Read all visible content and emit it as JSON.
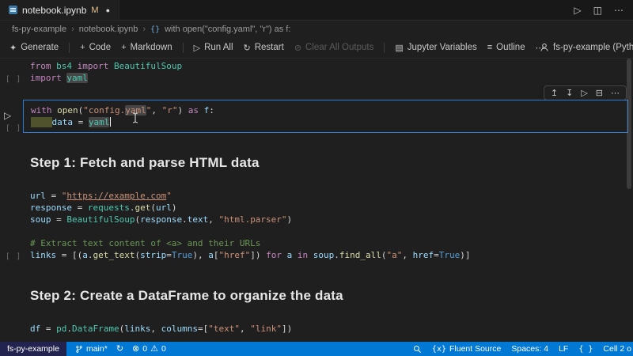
{
  "colors": {
    "accent": "#0078d4",
    "status_bar": "#0078d4",
    "remote_badge_bg": "#23234f",
    "focused_cell_border": "#2f7cd6",
    "syntax": {
      "keyword": "#C586C0",
      "function": "#DCDCAA",
      "string": "#CE9178",
      "variable": "#9CDCFE",
      "class": "#4EC9B0",
      "comment": "#6A9955",
      "constant": "#569CD6"
    }
  },
  "tab_bar": {
    "tab": {
      "title": "notebook.ipynb",
      "git_badge": "M",
      "dirty_dot": "●"
    },
    "actions": [
      {
        "name": "run",
        "glyph": "▷"
      },
      {
        "name": "split-editor",
        "glyph": "◫"
      },
      {
        "name": "more-actions",
        "glyph": "⋯"
      }
    ]
  },
  "breadcrumbs": {
    "separator": "›",
    "symbol_glyph": "{}",
    "items": [
      "fs-py-example",
      "notebook.ipynb",
      "with open(\"config.yaml\", \"r\") as f:"
    ]
  },
  "toolbar": {
    "buttons": [
      {
        "icon": "✦",
        "label": "Generate"
      },
      {
        "icon": "+",
        "label": "Code"
      },
      {
        "icon": "+",
        "label": "Markdown"
      },
      {
        "icon": "▷",
        "label": "Run All"
      },
      {
        "icon": "↻",
        "label": "Restart"
      },
      {
        "icon": "⊘",
        "label": "Clear All Outputs"
      },
      {
        "icon": "▤",
        "label": "Jupyter Variables"
      },
      {
        "icon": "≡",
        "label": "Outline"
      },
      {
        "icon": "⋯",
        "label": ""
      }
    ],
    "kernel": {
      "label": "fs-py-example (Python"
    }
  },
  "cell_toolbar": {
    "icons": [
      {
        "name": "run-above",
        "glyph": "↥"
      },
      {
        "name": "run-below",
        "glyph": "↧"
      },
      {
        "name": "run-cell",
        "glyph": "▷"
      },
      {
        "name": "split-cell",
        "glyph": "⊟"
      },
      {
        "name": "more",
        "glyph": "⋯"
      }
    ]
  },
  "cells": [
    {
      "type": "code",
      "exec": "[ ]",
      "lines": [
        [
          [
            "from",
            "kw"
          ],
          [
            " "
          ],
          [
            "bs4",
            "cls"
          ],
          [
            " "
          ],
          [
            "import",
            "kw"
          ],
          [
            " "
          ],
          [
            "BeautifulSoup",
            "cls"
          ]
        ],
        [
          [
            "import",
            "kw"
          ],
          [
            " "
          ],
          [
            "yaml",
            "cls occ"
          ]
        ]
      ]
    },
    {
      "type": "code",
      "exec": "[ ]",
      "run_glyph": "▷",
      "lines": [
        [
          [
            "with",
            "kw"
          ],
          [
            " "
          ],
          [
            "open",
            "fn"
          ],
          [
            "(",
            "pln"
          ],
          [
            "\"config.",
            "str"
          ],
          [
            "yaml",
            "str occ"
          ],
          [
            "\"",
            "str"
          ],
          [
            ", ",
            "pln"
          ],
          [
            "\"r\"",
            "str"
          ],
          [
            ") ",
            "pln"
          ],
          [
            "as",
            "kw"
          ],
          [
            " ",
            "pln"
          ],
          [
            "f",
            "var"
          ],
          [
            ":",
            "pln"
          ]
        ],
        [
          [
            "    ",
            "ind"
          ],
          [
            "data",
            "var"
          ],
          [
            " = ",
            "pln"
          ],
          [
            "yaml",
            "cls occ"
          ],
          [
            "",
            "caret"
          ]
        ]
      ]
    },
    {
      "type": "markdown",
      "text": "Step 1: Fetch and parse HTML data"
    },
    {
      "type": "code",
      "exec": "[ ]",
      "lines": [
        [
          [
            "url",
            "var"
          ],
          [
            " = ",
            "pln"
          ],
          [
            "\"",
            "str"
          ],
          [
            "https://example.com",
            "str und"
          ],
          [
            "\"",
            "str"
          ]
        ],
        [
          [
            "response",
            "var"
          ],
          [
            " = ",
            "pln"
          ],
          [
            "requests",
            "cls"
          ],
          [
            ".",
            "pln"
          ],
          [
            "get",
            "fn"
          ],
          [
            "(",
            "pln"
          ],
          [
            "url",
            "var"
          ],
          [
            ")",
            "pln"
          ]
        ],
        [
          [
            "soup",
            "var"
          ],
          [
            " = ",
            "pln"
          ],
          [
            "BeautifulSoup",
            "cls"
          ],
          [
            "(",
            "pln"
          ],
          [
            "response",
            "var"
          ],
          [
            ".",
            "pln"
          ],
          [
            "text",
            "var"
          ],
          [
            ", ",
            "pln"
          ],
          [
            "\"html.parser\"",
            "str"
          ],
          [
            ")",
            "pln"
          ]
        ],
        [],
        [
          [
            "# Extract text content of <a> and their URLs",
            "cmt"
          ]
        ],
        [
          [
            "links",
            "var"
          ],
          [
            " = [(",
            "pln"
          ],
          [
            "a",
            "var"
          ],
          [
            ".",
            "pln"
          ],
          [
            "get_text",
            "fn"
          ],
          [
            "(",
            "pln"
          ],
          [
            "strip",
            "var"
          ],
          [
            "=",
            "pln"
          ],
          [
            "True",
            "cst"
          ],
          [
            "), ",
            "pln"
          ],
          [
            "a",
            "var"
          ],
          [
            "[",
            "pln"
          ],
          [
            "\"href\"",
            "str"
          ],
          [
            "]) ",
            "pln"
          ],
          [
            "for",
            "kw"
          ],
          [
            " ",
            "pln"
          ],
          [
            "a",
            "var"
          ],
          [
            " ",
            "pln"
          ],
          [
            "in",
            "kw"
          ],
          [
            " ",
            "pln"
          ],
          [
            "soup",
            "var"
          ],
          [
            ".",
            "pln"
          ],
          [
            "find_all",
            "fn"
          ],
          [
            "(",
            "pln"
          ],
          [
            "\"a\"",
            "str"
          ],
          [
            ", ",
            "pln"
          ],
          [
            "href",
            "var"
          ],
          [
            "=",
            "pln"
          ],
          [
            "True",
            "cst"
          ],
          [
            ")]",
            "pln"
          ]
        ]
      ]
    },
    {
      "type": "markdown",
      "text": "Step 2: Create a DataFrame to organize the data"
    },
    {
      "type": "code",
      "exec": "[ ]",
      "lines": [
        [
          [
            "df",
            "var"
          ],
          [
            " = ",
            "pln"
          ],
          [
            "pd",
            "cls"
          ],
          [
            ".",
            "pln"
          ],
          [
            "DataFrame",
            "cls"
          ],
          [
            "(",
            "pln"
          ],
          [
            "links",
            "var"
          ],
          [
            ", ",
            "pln"
          ],
          [
            "columns",
            "var"
          ],
          [
            "=[",
            "pln"
          ],
          [
            "\"text\"",
            "str"
          ],
          [
            ", ",
            "pln"
          ],
          [
            "\"link\"",
            "str"
          ],
          [
            "])",
            "pln"
          ]
        ]
      ]
    }
  ],
  "status_bar": {
    "remote": "fs-py-example",
    "branch": "main*",
    "sync_glyph": "↻",
    "error_glyph": "⊗",
    "errors": "0",
    "warning_glyph": "⚠",
    "warnings": "0",
    "fluent_icon": "{x}",
    "fluent_label": "Fluent Source",
    "spaces": "Spaces: 4",
    "eol": "LF",
    "lang_icon": "{ }",
    "cell_indicator": "Cell 2 o"
  }
}
